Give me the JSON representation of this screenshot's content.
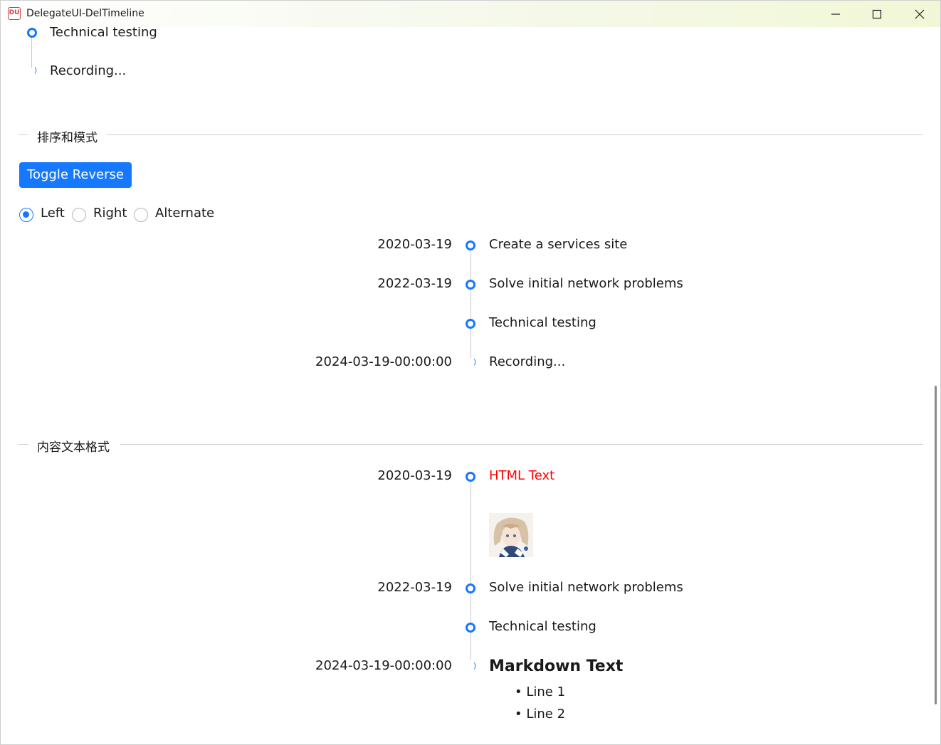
{
  "window": {
    "title": "DelegateUI-DelTimeline"
  },
  "top_section": {
    "items": [
      {
        "content": "Technical testing"
      },
      {
        "content": "Recording..."
      }
    ]
  },
  "sort_mode_section": {
    "title": "排序和模式",
    "toggle_button": "Toggle Reverse",
    "mode_options": [
      {
        "label": "Left",
        "checked": true
      },
      {
        "label": "Right",
        "checked": false
      },
      {
        "label": "Alternate",
        "checked": false
      }
    ],
    "timeline": [
      {
        "time": "2020-03-19",
        "content": "Create a services site"
      },
      {
        "time": "2022-03-19",
        "content": "Solve initial network problems"
      },
      {
        "time": "",
        "content": "Technical testing"
      },
      {
        "time": "2024-03-19-00:00:00",
        "content": "Recording..."
      }
    ]
  },
  "content_format_section": {
    "title": "内容文本格式",
    "timeline": [
      {
        "time": "2020-03-19",
        "content": "HTML Text",
        "color": "#ff0000"
      },
      {
        "time": "2022-03-19",
        "content": "Solve initial network problems"
      },
      {
        "time": "",
        "content": "Technical testing"
      },
      {
        "time": "2024-03-19-00:00:00",
        "content": "Markdown Text",
        "list": [
          "Line 1",
          "Line 2"
        ]
      }
    ]
  },
  "colors": {
    "accent": "#1677ff",
    "html_text": "#ff0000"
  }
}
